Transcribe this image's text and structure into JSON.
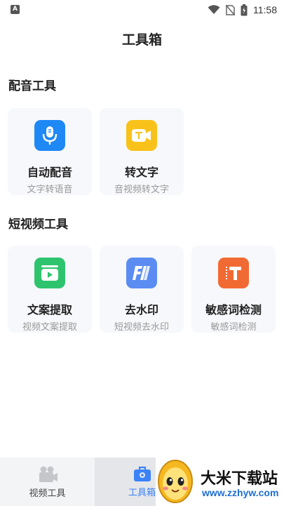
{
  "status_bar": {
    "time": "11:58",
    "left_badge": "A",
    "icons": [
      "wifi-icon",
      "no-sim-icon",
      "battery-charging-icon"
    ]
  },
  "page_title": "工具箱",
  "sections": [
    {
      "title": "配音工具",
      "tools": [
        {
          "name": "自动配音",
          "desc": "文字转语音",
          "icon": "microphone-icon",
          "color": "#1e88f5"
        },
        {
          "name": "转文字",
          "desc": "音视频转文字",
          "icon": "video-text-icon",
          "color": "#f8c21a"
        }
      ]
    },
    {
      "title": "短视频工具",
      "tools": [
        {
          "name": "文案提取",
          "desc": "视频文案提取",
          "icon": "video-play-icon",
          "color": "#2ec46e"
        },
        {
          "name": "去水印",
          "desc": "短视频去水印",
          "icon": "watermark-remove-icon",
          "color": "#5b8cf2"
        },
        {
          "name": "敏感词检测",
          "desc": "敏感词检测",
          "icon": "sensitive-word-icon",
          "color": "#f26a33"
        }
      ]
    }
  ],
  "bottom_nav": [
    {
      "label": "视频工具",
      "icon": "video-tools-icon",
      "active": false
    },
    {
      "label": "工具箱",
      "icon": "toolbox-icon",
      "active": true
    }
  ],
  "watermark": {
    "title": "大米下载站",
    "url": "www.zzhyw.com"
  },
  "colors": {
    "accent": "#3b82f6",
    "card_bg": "#f7f8fb",
    "nav_bg": "#f3f4f6"
  }
}
